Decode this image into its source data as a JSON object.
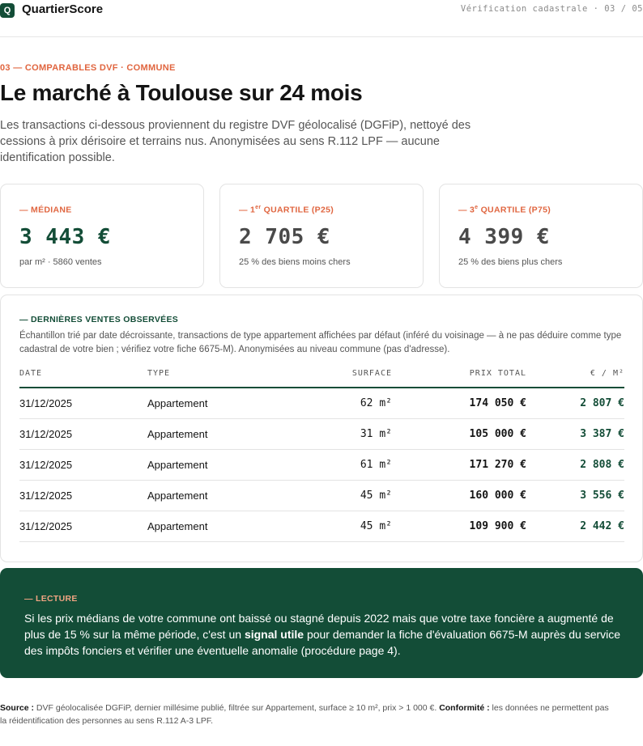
{
  "header": {
    "logo_letter": "Q",
    "brand": "QuartierScore",
    "step": "Vérification cadastrale · 03 / 05"
  },
  "section": {
    "eyebrow": "03 — COMPARABLES DVF · COMMUNE",
    "title": "Le marché à Toulouse sur 24 mois",
    "intro": "Les transactions ci-dessous proviennent du registre DVF géolocalisé (DGFiP), nettoyé des cessions à prix dérisoire et terrains nus. Anonymisées au sens R.112 LPF — aucune identification possible."
  },
  "stats": [
    {
      "label_prefix": "— MÉDIANE",
      "label_sup": "",
      "label_suffix": "",
      "value": "3 443 €",
      "sub": "par m² · 5860 ventes"
    },
    {
      "label_prefix": "— 1",
      "label_sup": "er",
      "label_suffix": " QUARTILE (P25)",
      "value": "2 705 €",
      "sub": "25 % des biens moins chers"
    },
    {
      "label_prefix": "— 3",
      "label_sup": "e",
      "label_suffix": " QUARTILE (P75)",
      "value": "4 399 €",
      "sub": "25 % des biens plus chers"
    }
  ],
  "sales": {
    "title": "— DERNIÈRES VENTES OBSERVÉES",
    "description": "Échantillon trié par date décroissante, transactions de type appartement affichées par défaut (inféré du voisinage — à ne pas déduire comme type cadastral de votre bien ; vérifiez votre fiche 6675-M). Anonymisées au niveau commune (pas d'adresse).",
    "columns": [
      "DATE",
      "TYPE",
      "SURFACE",
      "PRIX TOTAL",
      "€ / M²"
    ],
    "rows": [
      {
        "date": "31/12/2025",
        "type": "Appartement",
        "surface": "62 m²",
        "price": "174 050 €",
        "per_m2": "2 807 €"
      },
      {
        "date": "31/12/2025",
        "type": "Appartement",
        "surface": "31 m²",
        "price": "105 000 €",
        "per_m2": "3 387 €"
      },
      {
        "date": "31/12/2025",
        "type": "Appartement",
        "surface": "61 m²",
        "price": "171 270 €",
        "per_m2": "2 808 €"
      },
      {
        "date": "31/12/2025",
        "type": "Appartement",
        "surface": "45 m²",
        "price": "160 000 €",
        "per_m2": "3 556 €"
      },
      {
        "date": "31/12/2025",
        "type": "Appartement",
        "surface": "45 m²",
        "price": "109 900 €",
        "per_m2": "2 442 €"
      }
    ]
  },
  "reading": {
    "label": "— LECTURE",
    "text_before": "Si les prix médians de votre commune ont baissé ou stagné depuis 2022 mais que votre taxe foncière a augmenté de plus de 15 % sur la même période, c'est un ",
    "text_bold": "signal utile",
    "text_after": " pour demander la fiche d'évaluation 6675-M auprès du service des impôts fonciers et vérifier une éventuelle anomalie (procédure page 4)."
  },
  "footnote": {
    "source_label": "Source :",
    "source_text": " DVF géolocalisée DGFiP, dernier millésime publié, filtrée sur Appartement, surface ≥ 10 m², prix > 1 000 €. ",
    "conformity_label": "Conformité :",
    "conformity_text": " les données ne permettent pas la réidentification des personnes au sens R.112 A-3 LPF."
  },
  "colors": {
    "accent": "#e0653f",
    "brand_green": "#134d37",
    "text_muted": "#555555"
  }
}
